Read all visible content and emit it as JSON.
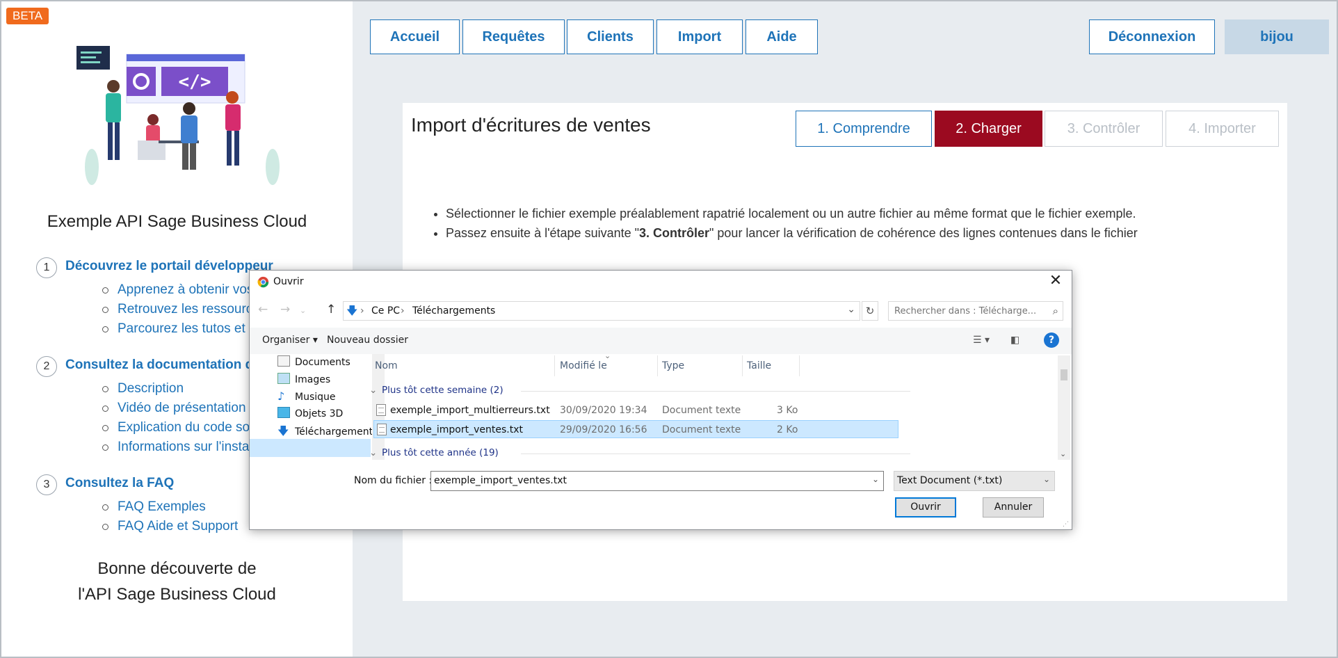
{
  "badge": "BETA",
  "sidebar": {
    "title": "Exemple API Sage Business Cloud",
    "sections": [
      {
        "num": "1",
        "title": "Découvrez le portail développeur",
        "items": [
          "Apprenez à obtenir vos",
          "Retrouvez les ressource",
          "Parcourez les tutos et e"
        ]
      },
      {
        "num": "2",
        "title": "Consultez la documentation de l",
        "items": [
          "Description",
          "Vidéo de présentation",
          "Explication du code sou",
          "Informations sur l'insta"
        ]
      },
      {
        "num": "3",
        "title": "Consultez la FAQ",
        "items": [
          "FAQ Exemples",
          "FAQ Aide et Support"
        ]
      }
    ],
    "bottom_line1": "Bonne découverte de",
    "bottom_line2": "l'API Sage Business Cloud"
  },
  "nav": {
    "items": [
      "Accueil",
      "Requêtes",
      "Clients",
      "Import",
      "Aide"
    ],
    "logout": "Déconnexion",
    "user": "bijou"
  },
  "main": {
    "title": "Import d'écritures de ventes",
    "steps": [
      "1. Comprendre",
      "2. Charger",
      "3. Contrôler",
      "4. Importer"
    ],
    "bullet1": "Sélectionner le fichier exemple préalablement rapatrié localement ou un autre fichier au même format que le fichier exemple.",
    "bullet2_pre": "Passez ensuite à l'étape suivante \"",
    "bullet2_bold": "3. Contrôler",
    "bullet2_post": "\" pour lancer la vérification de cohérence des lignes contenues dans le fichier"
  },
  "dialog": {
    "title": "Ouvrir",
    "path": [
      "Ce PC",
      "Téléchargements"
    ],
    "search_placeholder": "Rechercher dans : Télécharge...",
    "organize": "Organiser",
    "new_folder": "Nouveau dossier",
    "tree": [
      "Documents",
      "Images",
      "Musique",
      "Objets 3D",
      "Téléchargements"
    ],
    "columns": [
      "Nom",
      "Modifié le",
      "Type",
      "Taille"
    ],
    "group1": "Plus tôt cette semaine (2)",
    "group2": "Plus tôt cette année (19)",
    "files": [
      {
        "name": "exemple_import_multierreurs.txt",
        "date": "30/09/2020 19:34",
        "type": "Document texte",
        "size": "3 Ko"
      },
      {
        "name": "exemple_import_ventes.txt",
        "date": "29/09/2020 16:56",
        "type": "Document texte",
        "size": "2 Ko"
      }
    ],
    "filename_label": "Nom du fichier :",
    "filename_value": "exemple_import_ventes.txt",
    "filetype": "Text Document (*.txt)",
    "open": "Ouvrir",
    "cancel": "Annuler"
  },
  "colors": {
    "brand_blue": "#1e73b8",
    "active_step": "#9b0a20",
    "beta": "#f06a1d"
  }
}
